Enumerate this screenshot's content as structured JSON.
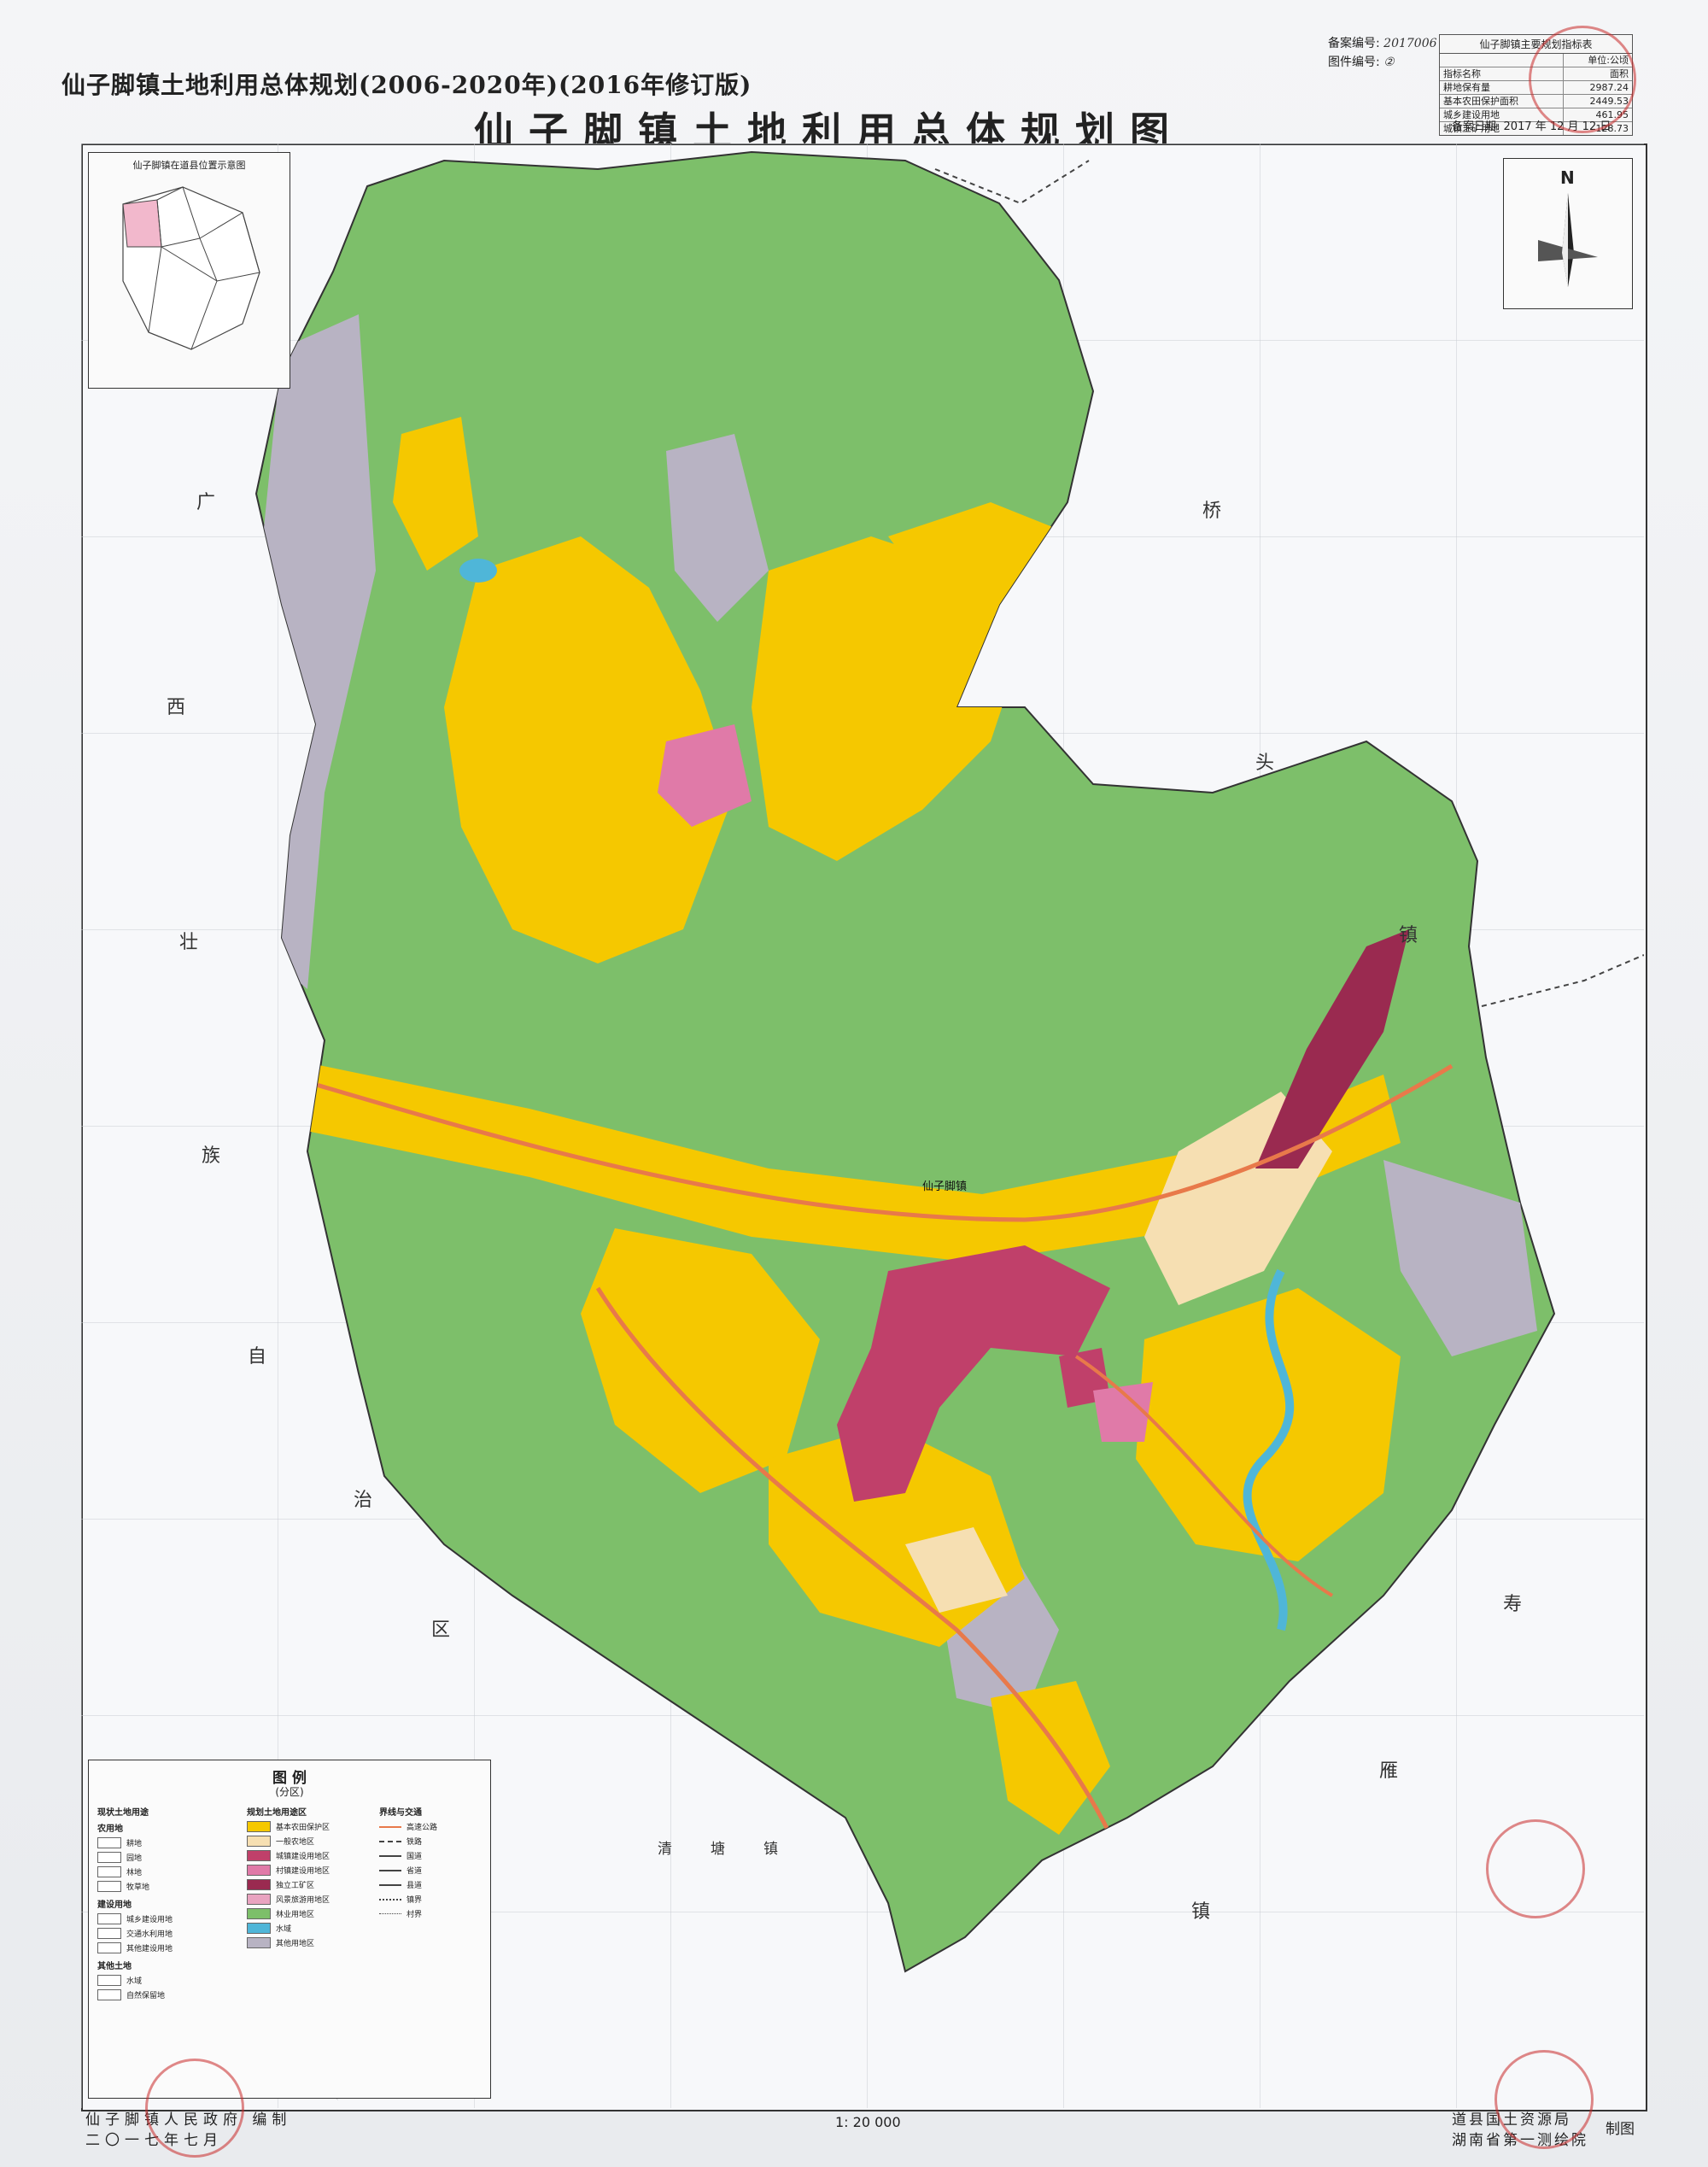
{
  "header": {
    "subtitle": "仙子脚镇土地利用总体规划(2006-2020年)(2016年修订版)",
    "title": "仙子脚镇土地利用总体规划图"
  },
  "records": {
    "record_no_label": "备案编号:",
    "record_no_value": "2017006",
    "sheet_no_label": "图件编号:",
    "sheet_no_value": "②",
    "record_date_label": "备案日期:",
    "record_date_value": "2017 年 12 月 12 日"
  },
  "index_table": {
    "caption": "仙子脚镇主要规划指标表",
    "unit": "单位:公顷",
    "rows": [
      {
        "name": "指标名称",
        "value": "面积"
      },
      {
        "name": "耕地保有量",
        "value": "2987.24"
      },
      {
        "name": "基本农田保护面积",
        "value": "2449.53"
      },
      {
        "name": "城乡建设用地",
        "value": "461.95"
      },
      {
        "name": "城镇工矿用地",
        "value": "128.73"
      }
    ]
  },
  "inset": {
    "caption": "仙子脚镇在道县位置示意图"
  },
  "north_arrow": {
    "label": "N"
  },
  "neighbors": {
    "west": [
      "广",
      "西",
      "壮",
      "族",
      "自",
      "治",
      "区"
    ],
    "east_top": [
      "桥",
      "头",
      "镇"
    ],
    "east_bottom": [
      "寿",
      "雁",
      "镇"
    ],
    "south": "清塘镇"
  },
  "town_label": "仙子脚镇",
  "legend": {
    "title": "图 例",
    "subtitle": "(分区)",
    "col1_title": "现状土地用途",
    "col1_sections": [
      {
        "name": "农用地",
        "items": [
          "耕地",
          "园地",
          "林地",
          "牧草地"
        ]
      },
      {
        "name": "建设用地",
        "items": [
          "城乡建设用地",
          "交通水利用地",
          "其他建设用地"
        ]
      },
      {
        "name": "其他土地",
        "items": [
          "水域",
          "自然保留地"
        ]
      }
    ],
    "col2_title": "规划土地用途区",
    "col2_items": [
      {
        "label": "基本农田保护区",
        "color": "#f5c800"
      },
      {
        "label": "一般农地区",
        "color": "#f6dfb2"
      },
      {
        "label": "城镇建设用地区",
        "color": "#c0406a"
      },
      {
        "label": "村镇建设用地区",
        "color": "#e07aa8"
      },
      {
        "label": "独立工矿区",
        "color": "#9a2a50"
      },
      {
        "label": "风景旅游用地区",
        "color": "#e9a3c0"
      },
      {
        "label": "林业用地区",
        "color": "#7dbf6a"
      },
      {
        "label": "水域",
        "color": "#4fb6d8"
      },
      {
        "label": "其他用地区",
        "color": "#b8b3c3"
      }
    ],
    "col3_title": "界线与交通",
    "col3_items": [
      "高速公路",
      "铁路",
      "国道",
      "省道",
      "县道",
      "镇界",
      "村界"
    ]
  },
  "footer": {
    "left_line1": "仙子脚镇人民政府 编制",
    "left_line2": "二〇一七年七月",
    "scale": "1: 20 000",
    "right_line1": "道县国土资源局",
    "right_line2": "湖南省第一测绘院",
    "right_tail": "制图"
  },
  "colors": {
    "farmland": "#f5c800",
    "forest": "#7dbf6a",
    "town": "#c0406a",
    "village": "#e07aa8",
    "general_farm": "#f6dfb2",
    "water": "#4fb6d8",
    "other": "#b8b3c3"
  }
}
